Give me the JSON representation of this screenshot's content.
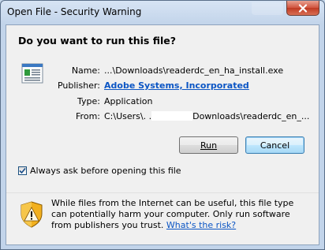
{
  "window": {
    "title": "Open File - Security Warning"
  },
  "dialog": {
    "heading": "Do you want to run this file?",
    "rows": [
      {
        "label": "Name:",
        "value": "...\\Downloads\\readerdc_en_ha_install.exe"
      },
      {
        "label": "Publisher:",
        "value": "Adobe Systems, Incorporated"
      },
      {
        "label": "Type:",
        "value": "Application"
      },
      {
        "label": "From:",
        "value_prefix": "C:\\Users\\. .",
        "value_suffix": "Downloads\\readerdc_en_..."
      }
    ],
    "buttons": {
      "run": "Run",
      "cancel": "Cancel"
    },
    "checkbox": {
      "label": "Always ask before opening this file",
      "checked": true
    },
    "warning": {
      "text": "While files from the Internet can be useful, this file type can potentially harm your computer. Only run software from publishers you trust.",
      "link": "What's the risk?"
    }
  },
  "colors": {
    "link": "#0b55c4",
    "close_button": "#c9452d",
    "frame": "#c2d4ea"
  },
  "icons": {
    "close": "close-icon",
    "file": "application-file-icon",
    "warning": "warning-shield-icon",
    "check": "checkmark-icon"
  }
}
